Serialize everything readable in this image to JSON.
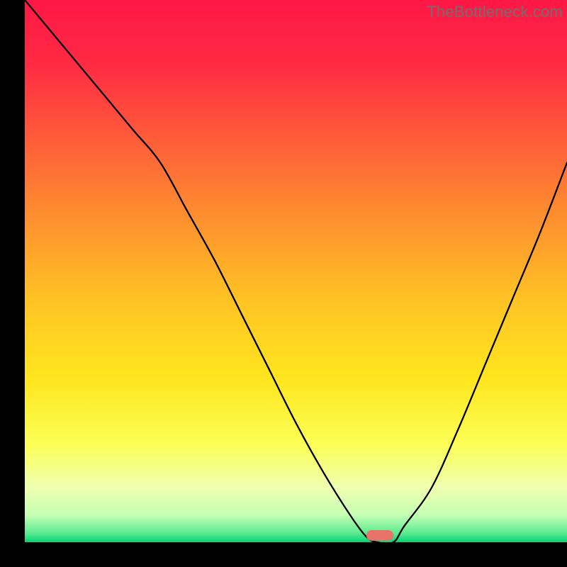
{
  "watermark": "TheBottleneck.com",
  "chart_data": {
    "type": "line",
    "title": "",
    "xlabel": "",
    "ylabel": "",
    "xlim": [
      0,
      100
    ],
    "ylim": [
      0,
      100
    ],
    "x": [
      0,
      5,
      10,
      15,
      20,
      25,
      30,
      35,
      40,
      45,
      50,
      55,
      60,
      63,
      65,
      68,
      70,
      75,
      80,
      85,
      90,
      95,
      100
    ],
    "values": [
      100,
      94,
      88,
      82,
      76,
      70,
      61,
      52,
      42,
      32,
      22,
      13,
      5,
      1,
      0,
      0,
      3,
      10,
      21,
      33,
      45,
      57,
      70
    ],
    "optimal_range_x": [
      63,
      68
    ],
    "gradient_stops": [
      {
        "pos": 0.0,
        "color": "#ff1746"
      },
      {
        "pos": 0.12,
        "color": "#ff2b43"
      },
      {
        "pos": 0.25,
        "color": "#ff5a3a"
      },
      {
        "pos": 0.4,
        "color": "#ff8f2f"
      },
      {
        "pos": 0.55,
        "color": "#ffc224"
      },
      {
        "pos": 0.7,
        "color": "#ffe61e"
      },
      {
        "pos": 0.82,
        "color": "#fbff56"
      },
      {
        "pos": 0.9,
        "color": "#efffb0"
      },
      {
        "pos": 0.95,
        "color": "#c5ffb4"
      },
      {
        "pos": 0.985,
        "color": "#57e88f"
      },
      {
        "pos": 1.0,
        "color": "#00d474"
      }
    ],
    "marker": {
      "color": "#e8736b",
      "shape": "pill"
    }
  }
}
